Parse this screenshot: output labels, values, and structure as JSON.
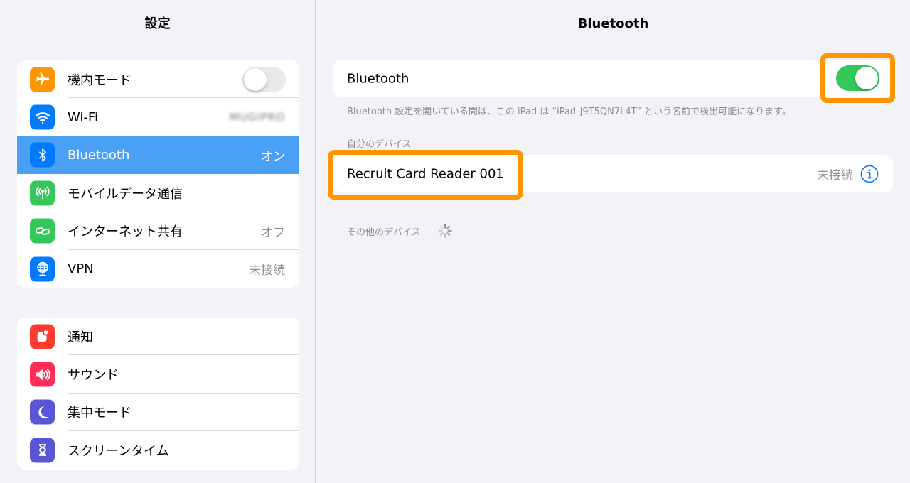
{
  "sidebar": {
    "title": "設定",
    "group1": [
      {
        "label": "機内モード",
        "icon": "airplane-icon",
        "color": "#ff9500"
      },
      {
        "label": "Wi-Fi",
        "value": "MUGIPRO",
        "icon": "wifi-icon",
        "color": "#007aff"
      },
      {
        "label": "Bluetooth",
        "value": "オン",
        "icon": "bluetooth-icon",
        "color": "#007aff"
      },
      {
        "label": "モバイルデータ通信",
        "icon": "antenna-icon",
        "color": "#34c759"
      },
      {
        "label": "インターネット共有",
        "value": "オフ",
        "icon": "link-icon",
        "color": "#34c759"
      },
      {
        "label": "VPN",
        "value": "未接続",
        "icon": "globe-icon",
        "color": "#007aff"
      }
    ],
    "group2": [
      {
        "label": "通知",
        "icon": "notification-icon",
        "color": "#ff3b30"
      },
      {
        "label": "サウンド",
        "icon": "speaker-icon",
        "color": "#ff2d55"
      },
      {
        "label": "集中モード",
        "icon": "moon-icon",
        "color": "#5856d6"
      },
      {
        "label": "スクリーンタイム",
        "icon": "hourglass-icon",
        "color": "#5856d6"
      }
    ]
  },
  "detail": {
    "title": "Bluetooth",
    "bluetooth_label": "Bluetooth",
    "bluetooth_on": true,
    "footnote": "Bluetooth 設定を開いている間は、この iPad は “iPad-J9T5QN7L4T” という名前で検出可能になります。",
    "my_devices_header": "自分のデバイス",
    "device": {
      "name": "Recruit Card Reader 001",
      "status": "未接続"
    },
    "other_devices_header": "その他のデバイス"
  },
  "colors": {
    "accent": "#007aff",
    "selected": "#4aa0f5",
    "highlight": "#ff9500",
    "toggle_on": "#34c759"
  }
}
